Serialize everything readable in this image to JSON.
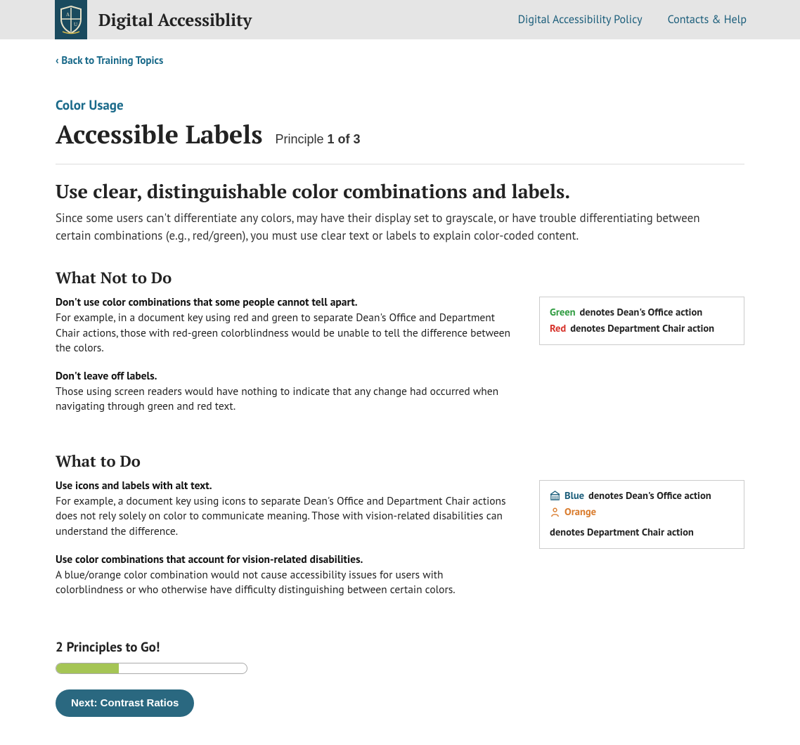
{
  "header": {
    "brand": "Digital Accessiblity",
    "nav": {
      "policy": "Digital Accessibility Policy",
      "contacts": "Contacts & Help"
    }
  },
  "backlink": "‹ Back to Training Topics",
  "section_label": "Color Usage",
  "title": "Accessible Labels",
  "principle": {
    "prefix": "Principle ",
    "position": "1 of 3"
  },
  "subhead": "Use clear, distinguishable color combinations and labels.",
  "intro": "Since some users can't differentiate any colors, may have their display set to grayscale, or have trouble differentiating between certain combinations (e.g., red/green), you must use clear text or labels to explain color-coded content.",
  "what_not": {
    "heading": "What Not to Do",
    "p1_bold": "Don't use color combinations that some people cannot tell apart.",
    "p1_body": "For example, in a document key using red and green to separate Dean's Office and Department Chair actions, those with red-green colorblindness would be unable to tell the difference between the colors.",
    "p2_bold": "Don't leave off labels.",
    "p2_body": "Those using screen readers would have nothing to indicate that any change had occurred when navigating through green and red text."
  },
  "bad_example": {
    "line1_color": "Green",
    "line1_text": " denotes Dean's Office action",
    "line2_color": "Red",
    "line2_text": " denotes Department Chair action"
  },
  "what_to": {
    "heading": "What to Do",
    "p1_bold": "Use icons and labels with alt text.",
    "p1_body": "For example, a document key using icons to separate Dean's Office and Department Chair actions does not rely solely on color to communicate meaning. Those with vision-related disabilities can understand the difference.",
    "p2_bold": "Use color combinations that account for vision-related disabilities.",
    "p2_body": "A blue/orange color combination would not cause accessibility issues for users with colorblindness or who otherwise have difficulty distinguishing between certain colors."
  },
  "good_example": {
    "line1_color": "Blue",
    "line1_text": " denotes Dean's Office action",
    "line2_color": "Orange",
    "line2_text": " denotes Department Chair action"
  },
  "progress": {
    "label": "2 Principles to Go!",
    "percent": 33
  },
  "next_button": "Next: Contrast Ratios"
}
